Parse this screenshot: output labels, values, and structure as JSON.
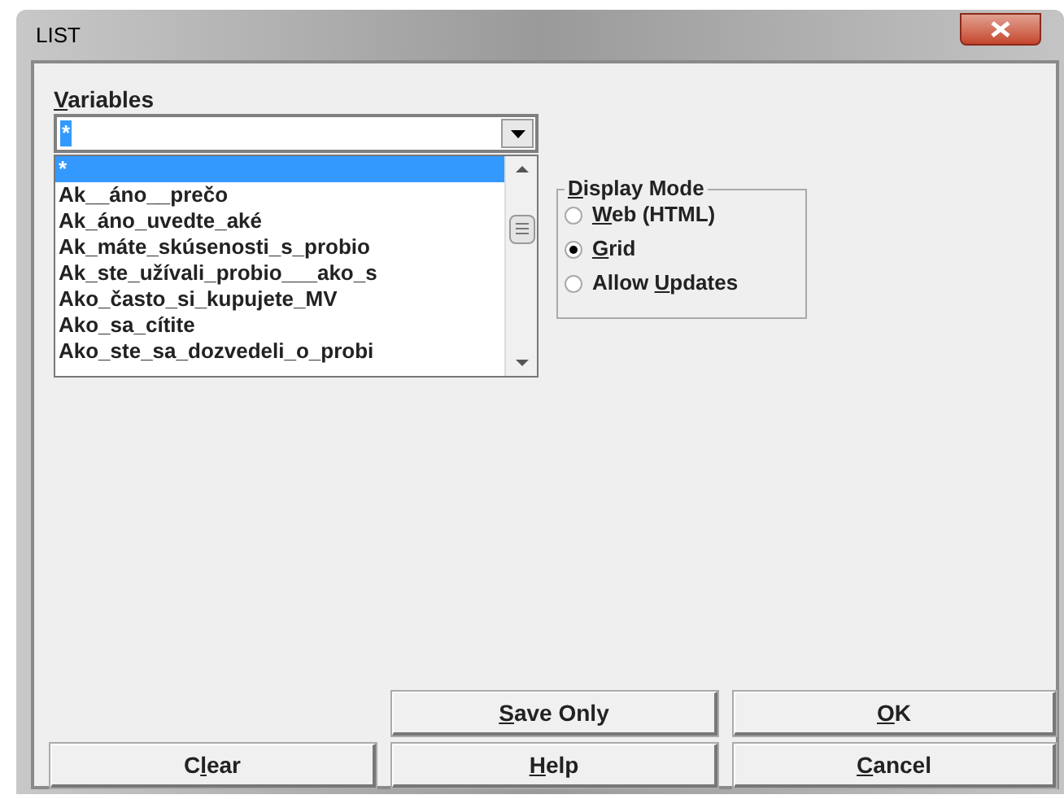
{
  "window": {
    "title": "LIST"
  },
  "variables": {
    "label": {
      "key": "V",
      "post": "ariables"
    },
    "value": "*",
    "list": [
      {
        "text": "*",
        "selected": true
      },
      {
        "text": "Ak__áno__prečo",
        "selected": false
      },
      {
        "text": "Ak_áno_uvedte_aké",
        "selected": false
      },
      {
        "text": "Ak_máte_skúsenosti_s_probio",
        "selected": false
      },
      {
        "text": "Ak_ste_užívali_probio___ako_s",
        "selected": false
      },
      {
        "text": "Ako_často_si_kupujete_MV",
        "selected": false
      },
      {
        "text": "Ako_sa_cítite",
        "selected": false
      },
      {
        "text": "Ako_ste_sa_dozvedeli_o_probi",
        "selected": false
      }
    ]
  },
  "display_mode": {
    "label": {
      "key": "D",
      "post": "isplay Mode"
    },
    "options": [
      {
        "label": {
          "key": "W",
          "post": "eb (HTML)"
        },
        "selected": false
      },
      {
        "label": {
          "key": "G",
          "post": "rid"
        },
        "selected": true
      },
      {
        "label": {
          "pre": "Allow ",
          "key": "U",
          "post": "pdates"
        },
        "selected": false
      }
    ]
  },
  "buttons": [
    {
      "label": {
        "key": "S",
        "post": "ave Only"
      }
    },
    {
      "label": {
        "key": "O",
        "post": "K"
      }
    },
    {
      "label": {
        "pre": "C",
        "key": "l",
        "post": "ear"
      }
    },
    {
      "label": {
        "key": "H",
        "post": "elp"
      }
    },
    {
      "label": {
        "key": "C",
        "post": "ancel"
      }
    }
  ]
}
